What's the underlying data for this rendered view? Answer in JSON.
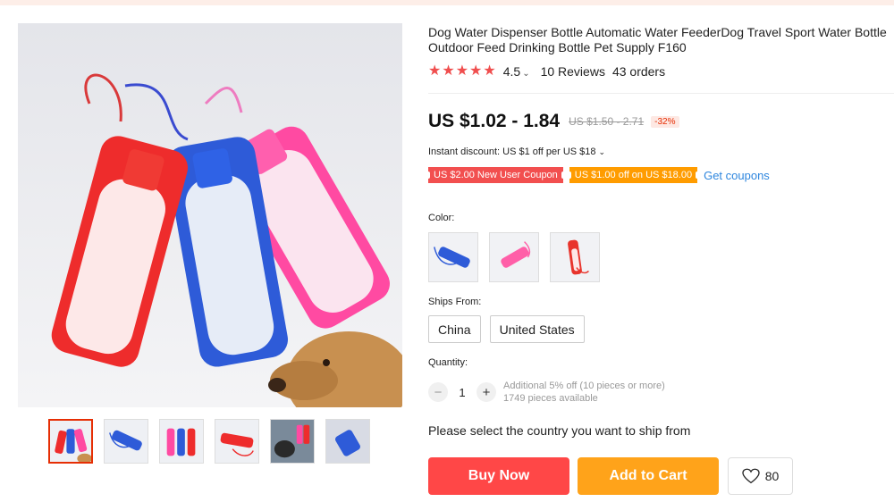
{
  "product": {
    "title": "Dog Water Dispenser Bottle Automatic Water FeederDog Travel Sport Water Bottle Outdoor Feed Drinking Bottle Pet Supply F160",
    "rating": "4.5",
    "reviews": "10 Reviews",
    "orders": "43 orders",
    "price": "US $1.02 - 1.84",
    "original_price": "US $1.50 - 2.71",
    "discount": "-32%",
    "instant_discount": "Instant discount: US $1 off per US $18",
    "coupons": [
      "US $2.00 New User Coupon",
      "US $1.00 off on US $18.00"
    ],
    "get_coupons": "Get coupons"
  },
  "color": {
    "label": "Color:",
    "options": [
      {
        "icon": "blue-bottle-icon",
        "accent": "#2f5fd6"
      },
      {
        "icon": "pink-bottle-icon",
        "accent": "#ff5fa8"
      },
      {
        "icon": "red-bottle-icon",
        "accent": "#e8342c"
      }
    ]
  },
  "shipping": {
    "label": "Ships From:",
    "options": [
      "China",
      "United States"
    ]
  },
  "quantity": {
    "label": "Quantity:",
    "minus": "−",
    "value": "1",
    "plus": "+",
    "note_discount": "Additional 5% off (10 pieces or more)",
    "note_available": "1749 pieces available"
  },
  "select_message": "Please select the country you want to ship from",
  "actions": {
    "buy_now": "Buy Now",
    "add_to_cart": "Add to Cart",
    "wishlist_count": "80"
  },
  "colors": {
    "price_red": "#e62e04",
    "buy_button": "#ff4747",
    "cart_button": "#ffa31a",
    "star": "#f04e4e",
    "link": "#2e86de"
  }
}
